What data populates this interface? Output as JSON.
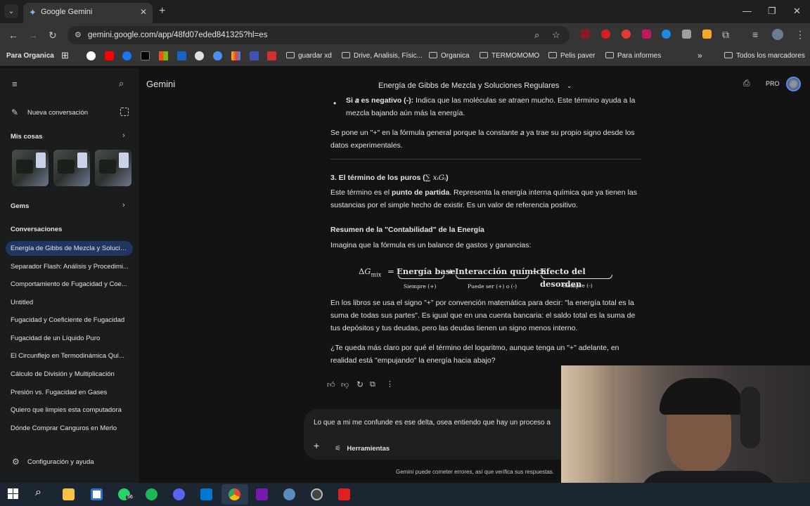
{
  "browser": {
    "tab_title": "Google Gemini",
    "url": "gemini.google.com/app/48fd07eded841325?hl=es",
    "window_controls": [
      "minimize-icon",
      "restore-icon",
      "close-icon"
    ]
  },
  "bookmarks": {
    "profile_label": "Para Organica",
    "folders": [
      "guardar xd",
      "Drive, Analisis, Físic...",
      "Organica",
      "TERMOMOMO",
      "Pelis paver",
      "Para informes"
    ],
    "all_bookmarks": "Todos los marcadores"
  },
  "sidebar": {
    "new_chat": "Nueva conversación",
    "my_stuff": "Mis cosas",
    "gems": "Gems",
    "conversations_header": "Conversaciones",
    "conversations": [
      "Energía de Gibbs de Mezcla y Solucio...",
      "Separador Flash: Análisis y Procedimi...",
      "Comportamiento de Fugacidad y Coe...",
      "Untitled",
      "Fugacidad y Coeficiente de Fugacidad",
      "Fugacidad de un Líquido Puro",
      "El Circunflejo en Termodinámica Quí...",
      "Cálculo de División y Multiplicación",
      "Presión vs. Fugacidad en Gases",
      "Quiero que limpies esta computadora",
      "Dónde Comprar Canguros en Merlo"
    ],
    "settings": "Configuración y ayuda"
  },
  "header": {
    "app_name": "Gemini",
    "chat_title": "Energía de Gibbs de Mezcla y Soluciones Regulares",
    "plan_badge": "PRO"
  },
  "content": {
    "bullet_bold": "Si 𝑎 es negativo (-):",
    "bullet_text": " Indica que las moléculas se atraen mucho. Este término ayuda a la mezcla bajando aún más la energía.",
    "para1": "Se pone un \"+\" en la fórmula general porque la constante 𝑎 ya trae su propio signo desde los datos experimentales.",
    "section3_title": "3. El término de los puros (",
    "section3_math": "∑ 𝑥ᵢ𝐺ᵢ",
    "section3_close": ")",
    "para2_a": "Este término es el ",
    "para2_bold": "punto de partida",
    "para2_b": ". Representa la energía interna química que ya tienen las sustancias por el simple hecho de existir. Es un valor de referencia positivo.",
    "summary_title": "Resumen de la \"Contabilidad\" de la Energía",
    "summary_intro": "Imagina que la fórmula es un balance de gastos y ganancias:",
    "eq_lhs": "Δ𝐺",
    "eq_sub": "mix",
    "eq_eq": "=",
    "eq_t1": "Energía base",
    "eq_t1_under": "Siempre (+)",
    "eq_plus": "+",
    "eq_t2": "Interacción química",
    "eq_t2_under": "Puede ser (+) o (-)",
    "eq_t3": "Efecto del desorden",
    "eq_t3_under": "Siempre (-)",
    "para3": "En los libros se usa el signo \"+\" por convención matemática para decir: \"la energía total es la suma de todas sus partes\". Es igual que en una cuenta bancaria: el saldo total es la suma de tus depósitos y tus deudas, pero las deudas tienen un signo menos interno.",
    "para4": "¿Te queda más claro por qué el término del logaritmo, aunque tenga un \"+\" adelante, en realidad está \"empujando\" la energía hacia abajo?"
  },
  "input": {
    "value": "Lo que a mi me confunde es ese delta, osea entiendo que hay un proceso a",
    "tools_label": "Herramientas"
  },
  "disclaimer": "Gemini puede cometer errores, así que verifica sus respuestas.",
  "taskbar": {
    "whatsapp_badge": "56"
  },
  "colors": {
    "accent": "#1f3760",
    "background": "#131314",
    "sidebar": "#1b1c1d"
  }
}
